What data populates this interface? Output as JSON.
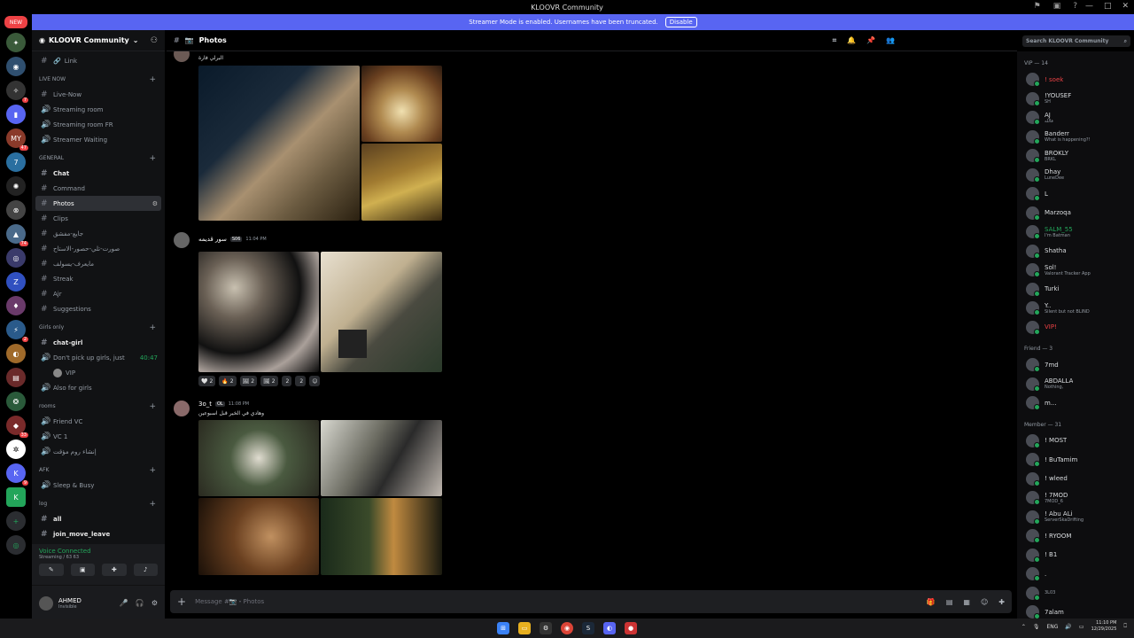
{
  "window": {
    "title": "KLOOVR Community"
  },
  "banner": {
    "text": "Streamer Mode is enabled. Usernames have been truncated.",
    "button": "Disable"
  },
  "guilds": {
    "new_label": "NEW",
    "badges": [
      "7",
      "47",
      "74",
      "2",
      "33",
      "9"
    ]
  },
  "server": {
    "name": "KLOOVR Community"
  },
  "channels": {
    "link": "Link",
    "cat_live": "LIVE NOW",
    "live_now": "Live-Now",
    "streaming_room": "Streaming room",
    "streaming_room_fr": "Streaming room FR",
    "streamer_waiting": "Streamer Waiting",
    "cat_general": "GENERAL",
    "chat": "Chat",
    "command": "Command",
    "photos": "Photos",
    "clips": "Clips",
    "ar1": "جايع-مفشق",
    "ar2": "صورت-تلي-حصور-الاستاح",
    "ar3": "مايعرف-يسولف",
    "streak": "Streak",
    "ajr": "Ajr",
    "suggestions": "Suggestions",
    "cat_girls": "Girls only",
    "chat_girl": "chat-girl",
    "dont_pick": "Don't pick up girls, just",
    "dont_pick_time": "40:47",
    "vip_user": "VIP",
    "also_girls": "Also for girls",
    "cat_rooms": "rooms",
    "friend_vc": "Friend VC",
    "vc1": "VC 1",
    "ar4": "إنشاء روم مؤقت",
    "cat_afk": "AFK",
    "sleep_busy": "Sleep & Busy",
    "cat_log": "log",
    "all": "all",
    "join_move_leave": "join_move_leave"
  },
  "voice": {
    "title": "Voice Connected",
    "sub": "Streaming / 63 63"
  },
  "user": {
    "name": "AHMED",
    "status": "Invisible"
  },
  "topbar": {
    "channel": "Photos",
    "search_placeholder": "Search KLOOVR Community"
  },
  "messages": [
    {
      "text": "البرلي فارة"
    },
    {
      "name": "سور قديمه",
      "tag": "S06",
      "time": "11:04 PM",
      "reactions": [
        {
          "e": "🤍",
          "c": "2"
        },
        {
          "e": "🔥",
          "c": "2"
        },
        {
          "e": "🖼",
          "c": "2"
        },
        {
          "e": "🖼",
          "c": "2"
        },
        {
          "e": "",
          "c": "2"
        },
        {
          "e": "",
          "c": "2"
        }
      ]
    },
    {
      "name": "3o_t",
      "tag": "OL",
      "time": "11:08 PM",
      "text": "وهادي في الخير قبل اسبوعين"
    }
  ],
  "composer": {
    "placeholder": "Message #📷・Photos"
  },
  "members": {
    "cat_vip": "VIP — 14",
    "vip": [
      {
        "n": "! soek",
        "s": "",
        "c": "#ed4245"
      },
      {
        "n": "!YOUSEF",
        "s": "SH",
        "c": "#dbdee1"
      },
      {
        "n": "AJ",
        "s": "فالله",
        "c": "#dbdee1"
      },
      {
        "n": "Banderr",
        "s": "What is happening?!",
        "c": "#dbdee1"
      },
      {
        "n": "BROKLY",
        "s": "BRKL",
        "c": "#dbdee1"
      },
      {
        "n": "Dhay",
        "s": "LuneDee",
        "c": "#dbdee1"
      },
      {
        "n": "L",
        "s": "",
        "c": "#dbdee1"
      },
      {
        "n": "Marzoqa",
        "s": "",
        "c": "#dbdee1"
      },
      {
        "n": "SALM_55",
        "s": "I'm Batman",
        "c": "#23a55a"
      },
      {
        "n": "Shatha",
        "s": "",
        "c": "#dbdee1"
      },
      {
        "n": "Sol!",
        "s": "Valorant Tracker App",
        "c": "#dbdee1"
      },
      {
        "n": "Turki",
        "s": "",
        "c": "#dbdee1"
      },
      {
        "n": "Y..",
        "s": "Silent but not BLIND",
        "c": "#dbdee1"
      },
      {
        "n": "VIP!",
        "s": "",
        "c": "#ed4245"
      }
    ],
    "cat_friend": "Friend — 3",
    "friend": [
      {
        "n": "7md",
        "s": "",
        "c": "#dbdee1"
      },
      {
        "n": "ABDALLA",
        "s": "Nothing,",
        "c": "#dbdee1"
      },
      {
        "n": "m...",
        "s": "",
        "c": "#dbdee1"
      }
    ],
    "cat_member": "Member — 31",
    "member": [
      {
        "n": "! MOST",
        "s": "",
        "c": "#dbdee1"
      },
      {
        "n": "! BuTamim",
        "s": "",
        "c": "#dbdee1"
      },
      {
        "n": "! wleed",
        "s": "",
        "c": "#dbdee1"
      },
      {
        "n": "! 7MOD",
        "s": "7MOD_6",
        "c": "#dbdee1"
      },
      {
        "n": "! Abu ALi",
        "s": "ServerSkaDrifting",
        "c": "#dbdee1"
      },
      {
        "n": "! RYOOM",
        "s": "",
        "c": "#dbdee1"
      },
      {
        "n": "! B1",
        "s": "",
        "c": "#dbdee1"
      },
      {
        "n": ".",
        "s": "",
        "c": "#dbdee1"
      },
      {
        "n": "",
        "s": "3L03",
        "c": "#dbdee1"
      },
      {
        "n": "7alam",
        "s": "",
        "c": "#dbdee1"
      }
    ]
  },
  "taskbar": {
    "lang": "ENG",
    "time": "11:10 PM",
    "date": "12/29/2025"
  }
}
